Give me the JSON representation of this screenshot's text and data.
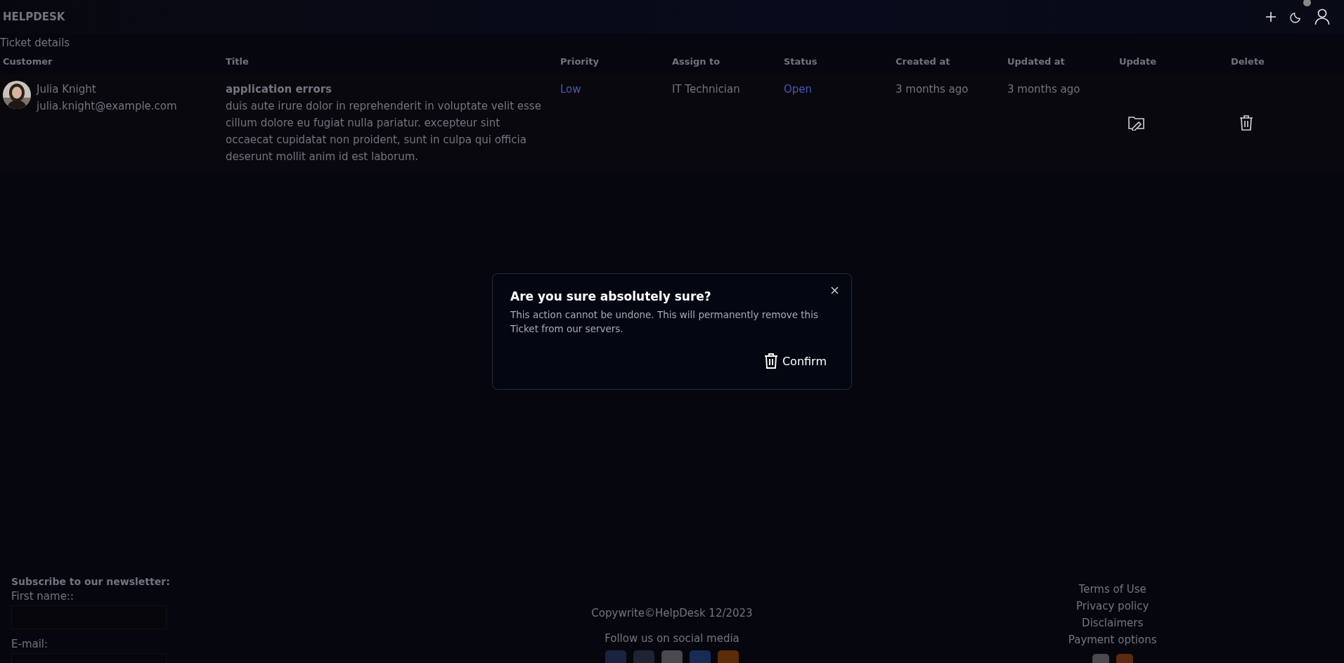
{
  "header": {
    "brand": "HELPDESK",
    "notification_dot": true
  },
  "page_title": "Ticket details",
  "table": {
    "columns": [
      "Customer",
      "Title",
      "Priority",
      "Assign to",
      "Status",
      "Created at",
      "Updated at",
      "Update",
      "Delete"
    ],
    "rows": [
      {
        "customer_name": "Julia Knight",
        "customer_email": "julia.knight@example.com",
        "title": "application errors",
        "description": "duis aute irure dolor in reprehenderit in voluptate velit esse cillum dolore eu fugiat nulla pariatur. excepteur sint occaecat cupidatat non proident, sunt in culpa qui officia deserunt mollit anim id est laborum.",
        "priority": "Low",
        "assign_to": "IT Technician",
        "status": "Open",
        "created_at": "3 months ago",
        "updated_at": "3 months ago"
      }
    ]
  },
  "dialog": {
    "title": "Are you sure absolutely sure?",
    "message": "This action cannot be undone. This will permanently remove this Ticket from our servers.",
    "confirm": "Confirm"
  },
  "footer": {
    "newsletter": {
      "heading": "Subscribe to our newsletter:",
      "fields": [
        {
          "label": "First name::"
        },
        {
          "label": "E-mail:"
        }
      ]
    },
    "copyright": "Copywrite©HelpDesk 12/2023",
    "social_heading": "Follow us on social media",
    "links": [
      "Terms of Use",
      "Privacy policy",
      "Disclaimers",
      "Payment options"
    ]
  }
}
